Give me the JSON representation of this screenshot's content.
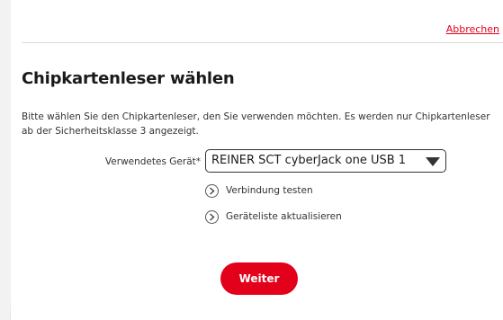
{
  "header": {
    "cancel_label": "Abbrechen"
  },
  "main": {
    "title": "Chipkartenleser wählen",
    "description": "Bitte wählen Sie den Chipkartenleser, den Sie verwenden möchten. Es werden nur Chipkartenleser ab der Sicherheitsklasse 3 angezeigt.",
    "device_field": {
      "label": "Verwendetes Gerät*",
      "selected_value": "REINER SCT cyberJack one USB 1"
    },
    "links": {
      "test_connection": "Verbindung testen",
      "refresh_list": "Geräteliste aktualisieren"
    },
    "submit_label": "Weiter"
  },
  "colors": {
    "accent": "#e2001a",
    "text": "#333333",
    "background": "#e6e6e6"
  },
  "icons": {
    "dropdown": "caret-down-icon",
    "link": "chevron-right-circle-icon"
  }
}
